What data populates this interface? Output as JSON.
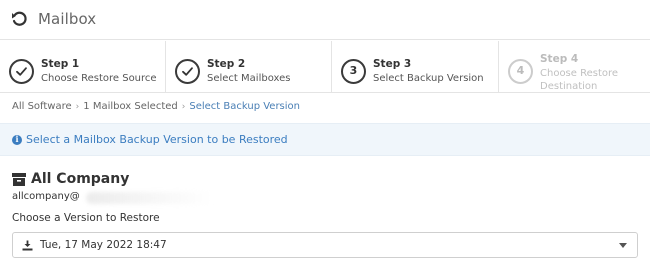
{
  "header": {
    "title": "Mailbox",
    "back_icon": "undo-arrow-icon"
  },
  "steps": [
    {
      "label": "Step 1",
      "sub": "Choose Restore Source",
      "state": "complete"
    },
    {
      "label": "Step 2",
      "sub": "Select Mailboxes",
      "state": "complete"
    },
    {
      "label": "Step 3",
      "sub": "Select Backup Version",
      "state": "current",
      "number": "3"
    },
    {
      "label": "Step 4",
      "sub": "Choose Restore Destination",
      "state": "disabled",
      "number": "4"
    }
  ],
  "breadcrumb": {
    "items": [
      "All Software",
      "1 Mailbox Selected",
      "Select Backup Version"
    ]
  },
  "banner": {
    "text": "Select a Mailbox Backup Version to be Restored",
    "icon": "info-icon",
    "color": "#3b7dc0"
  },
  "company": {
    "name": "All Company",
    "email": "allcompany@",
    "icon": "archive-icon"
  },
  "version": {
    "label": "Choose a Version to Restore",
    "selected": "Tue, 17 May 2022 18:47",
    "icon": "download-icon"
  }
}
